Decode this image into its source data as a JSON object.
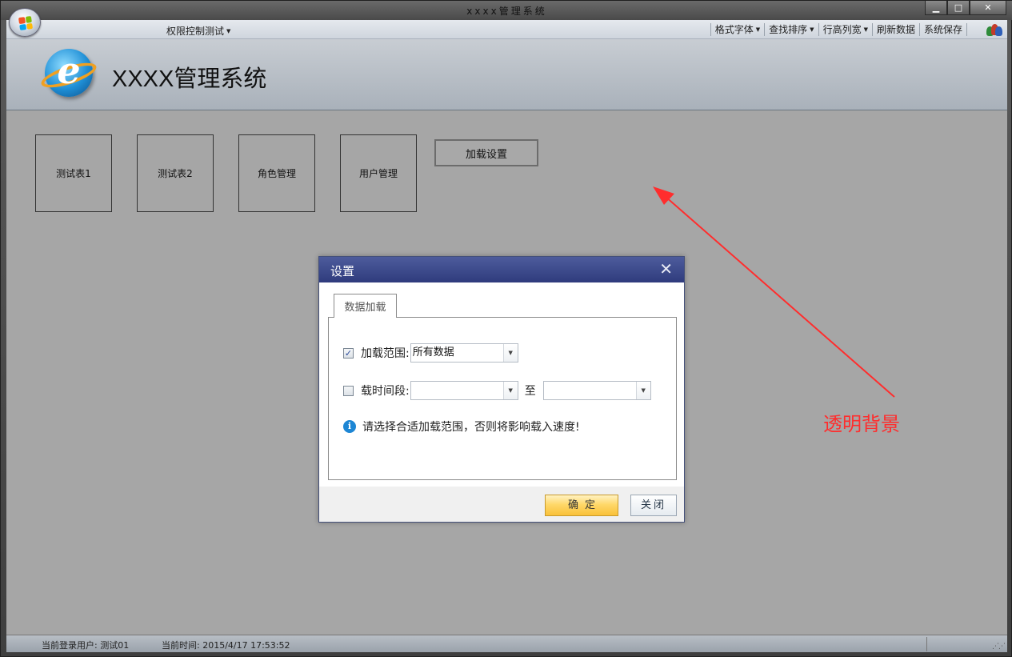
{
  "window": {
    "title": "xxxx管理系统",
    "minimize_glyph": "▁",
    "maximize_glyph": "□",
    "close_glyph": "✕"
  },
  "menubar": {
    "left_menu": "权限控制测试",
    "right_menus": [
      {
        "label": "格式字体",
        "has_dropdown": true
      },
      {
        "label": "查找排序",
        "has_dropdown": true
      },
      {
        "label": "行高列宽",
        "has_dropdown": true
      },
      {
        "label": "刷新数据",
        "has_dropdown": false
      },
      {
        "label": "系统保存",
        "has_dropdown": false
      }
    ],
    "user_icon": "users-icon"
  },
  "header": {
    "logo_letter": "e",
    "app_title": "XXXX管理系统"
  },
  "workarea": {
    "tiles": [
      "测试表1",
      "测试表2",
      "角色管理",
      "用户管理"
    ],
    "load_settings_button": "加载设置",
    "annotation_text": "透明背景",
    "annotation_color": "#ff2d2d"
  },
  "dialog": {
    "title": "设置",
    "close_glyph": "✕",
    "tab_label": "数据加载",
    "load_range": {
      "checked": true,
      "label": "加载范围:",
      "value": "所有数据"
    },
    "time_range": {
      "checked": false,
      "label": "载时间段:",
      "from_value": "",
      "to_label": "至",
      "to_value": ""
    },
    "info_glyph": "i",
    "info_text": "请选择合适加载范围，否则将影响载入速度!",
    "ok_button": "确定",
    "close_button": "关闭"
  },
  "statusbar": {
    "user_text": "当前登录用户: 测试01",
    "time_text": "当前时间: 2015/4/17 17:53:52"
  },
  "colors": {
    "dialog_title_bg": "#2f3b7d",
    "ok_button_bg": "#f9c13a",
    "workarea_bg": "#a6a6a6"
  }
}
